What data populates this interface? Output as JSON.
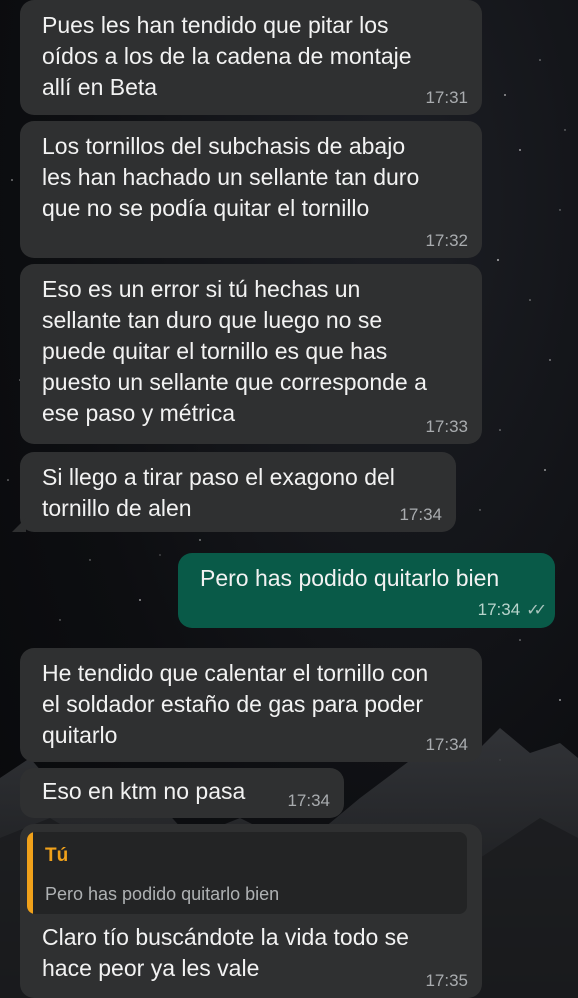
{
  "messages": [
    {
      "text": "Pues les han tendido que pitar los\noídos a los de la cadena de montaje\nallí en Beta",
      "time": "17:31"
    },
    {
      "text": "Los tornillos del subchasis de abajo\nles han hachado un sellante tan duro\nque no se podía quitar el tornillo",
      "time": "17:32"
    },
    {
      "text": "Eso es un error si tú hechas un\nsellante tan duro que luego no se\npuede quitar el tornillo es que has\npuesto un sellante que corresponde a\nese paso y métrica",
      "time": "17:33"
    },
    {
      "text": "Si llego a tirar paso el exagono del\ntornillo de alen",
      "time": "17:34"
    },
    {
      "text": "Pero has podido quitarlo bien",
      "time": "17:34",
      "status_icon": "double-check-read"
    },
    {
      "text": "He tendido que calentar el tornillo con\nel soldador estaño de gas para poder\nquitarlo",
      "time": "17:34"
    },
    {
      "text": "Eso en ktm no pasa",
      "time": "17:34"
    },
    {
      "quote": {
        "author": "Tú",
        "text": "Pero has podido quitarlo bien"
      },
      "text": "Claro tío buscándote la vida todo se\nhace peor ya les vale",
      "time": "17:35"
    }
  ],
  "colors": {
    "incoming_bubble": "#2f3031",
    "outgoing_bubble": "#095a48",
    "quote_accent": "#f0a11a"
  }
}
